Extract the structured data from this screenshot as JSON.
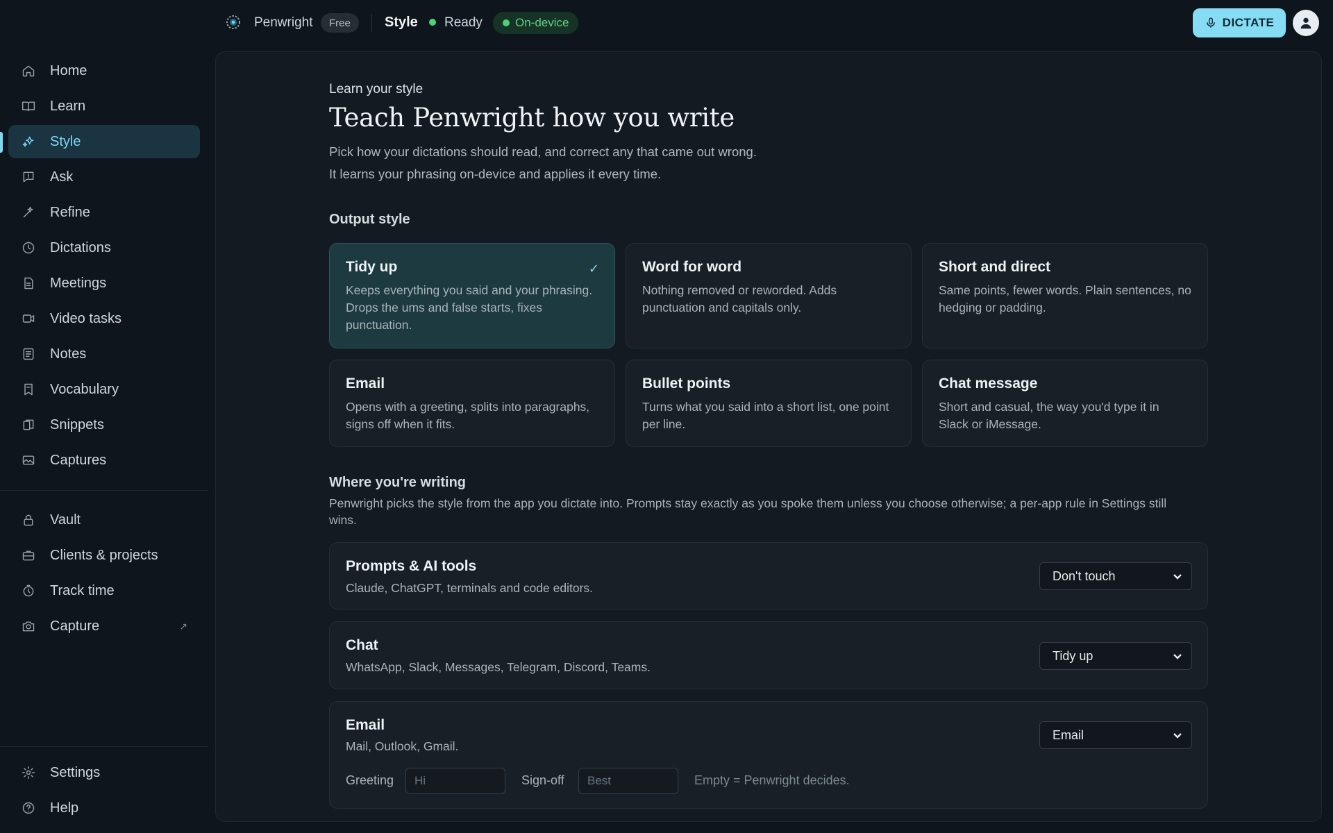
{
  "app": {
    "name": "Penwright",
    "plan_badge": "Free",
    "section": "Style",
    "status": "Ready",
    "mode_badge": "On-device",
    "dictate_label": "DICTATE"
  },
  "sidebar": {
    "items": [
      {
        "label": "Home",
        "icon": "home-icon"
      },
      {
        "label": "Learn",
        "icon": "book-icon"
      },
      {
        "label": "Style",
        "icon": "sparkle-icon",
        "active": true
      },
      {
        "label": "Ask",
        "icon": "chat-icon"
      },
      {
        "label": "Refine",
        "icon": "wand-icon"
      },
      {
        "label": "Dictations",
        "icon": "clock-icon"
      },
      {
        "label": "Meetings",
        "icon": "document-icon"
      },
      {
        "label": "Video tasks",
        "icon": "video-icon"
      },
      {
        "label": "Notes",
        "icon": "note-icon"
      },
      {
        "label": "Vocabulary",
        "icon": "vocabulary-icon"
      },
      {
        "label": "Snippets",
        "icon": "snippet-icon"
      },
      {
        "label": "Captures",
        "icon": "image-icon"
      }
    ],
    "secondary_items": [
      {
        "label": "Vault",
        "icon": "lock-icon"
      },
      {
        "label": "Clients & projects",
        "icon": "briefcase-icon"
      },
      {
        "label": "Track time",
        "icon": "stopwatch-icon"
      },
      {
        "label": "Capture",
        "icon": "camera-icon",
        "external": "↗"
      }
    ],
    "footer_items": [
      {
        "label": "Settings",
        "icon": "gear-icon"
      },
      {
        "label": "Help",
        "icon": "help-icon"
      }
    ]
  },
  "main": {
    "eyebrow": "Learn your style",
    "title": "Teach Penwright how you write",
    "subtitle_lines": [
      "Pick how your dictations should read, and correct any that came out wrong.",
      "It learns your phrasing on-device and applies it every time."
    ],
    "output_style": {
      "heading": "Output style",
      "options": [
        {
          "title": "Tidy up",
          "description": "Keeps everything you said and your phrasing. Drops the ums and false starts, fixes punctuation.",
          "selected": true
        },
        {
          "title": "Word for word",
          "description": "Nothing removed or reworded. Adds punctuation and capitals only."
        },
        {
          "title": "Short and direct",
          "description": "Same points, fewer words. Plain sentences, no hedging or padding."
        },
        {
          "title": "Email",
          "description": "Opens with a greeting, splits into paragraphs, signs off when it fits."
        },
        {
          "title": "Bullet points",
          "description": "Turns what you said into a short list, one point per line."
        },
        {
          "title": "Chat message",
          "description": "Short and casual, the way you'd type it in Slack or iMessage."
        }
      ]
    },
    "where_writing": {
      "heading": "Where you're writing",
      "description": "Penwright picks the style from the app you dictate into. Prompts stay exactly as you spoke them unless you choose otherwise; a per-app rule in Settings still wins.",
      "rules": [
        {
          "title": "Prompts & AI tools",
          "apps": "Claude, ChatGPT, terminals and code editors.",
          "value": "Don't touch"
        },
        {
          "title": "Chat",
          "apps": "WhatsApp, Slack, Messages, Telegram, Discord, Teams.",
          "value": "Tidy up"
        },
        {
          "title": "Email",
          "apps": "Mail, Outlook, Gmail.",
          "value": "Email",
          "greeting_label": "Greeting",
          "greeting_placeholder": "Hi",
          "signoff_label": "Sign-off",
          "signoff_placeholder": "Best",
          "hint": "Empty = Penwright decides."
        }
      ]
    }
  },
  "colors": {
    "accent": "#7fd6ee",
    "background": "#0f151c",
    "selected_card": "#1c3a40",
    "ready_green": "#4fd07a"
  }
}
